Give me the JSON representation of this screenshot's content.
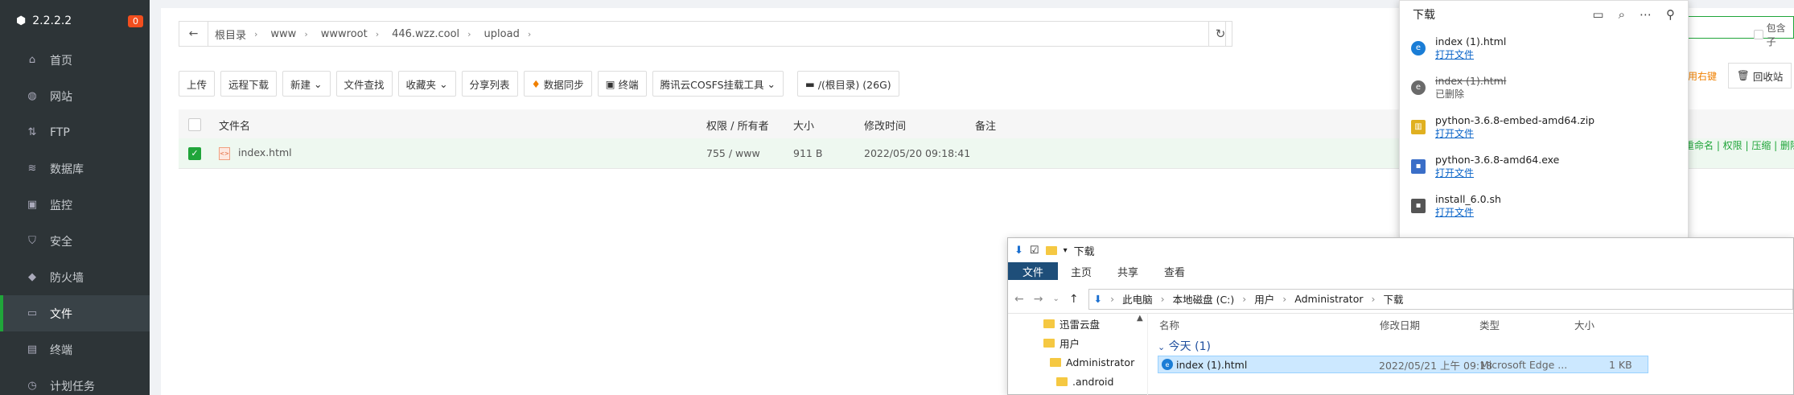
{
  "sidebar": {
    "version": "2.2.2.2",
    "badge": "0",
    "items": [
      {
        "label": "首页",
        "icon": "home-icon"
      },
      {
        "label": "网站",
        "icon": "globe-icon"
      },
      {
        "label": "FTP",
        "icon": "ftp-icon"
      },
      {
        "label": "数据库",
        "icon": "database-icon"
      },
      {
        "label": "监控",
        "icon": "monitor-icon"
      },
      {
        "label": "安全",
        "icon": "shield-icon"
      },
      {
        "label": "防火墙",
        "icon": "firewall-icon"
      },
      {
        "label": "文件",
        "icon": "folder-icon",
        "active": true
      },
      {
        "label": "终端",
        "icon": "terminal-icon"
      },
      {
        "label": "计划任务",
        "icon": "clock-icon"
      }
    ]
  },
  "breadcrumb": [
    "根目录",
    "www",
    "wwwroot",
    "446.wzz.cool",
    "upload"
  ],
  "toolbar": {
    "upload": "上传",
    "remote_download": "远程下载",
    "new": "新建",
    "file_search": "文件查找",
    "favorites": "收藏夹",
    "share_list": "分享列表",
    "sync": "数据同步",
    "terminal": "终端",
    "cosfs": "腾讯云COSFS挂载工具",
    "disk": "/(根目录) (26G)",
    "right_click": "用右键",
    "recycle": "回收站",
    "include_sub": "包含子"
  },
  "table": {
    "headers": {
      "name": "文件名",
      "perm": "权限 / 所有者",
      "size": "大小",
      "mtime": "修改时间",
      "note": "备注"
    },
    "rows": [
      {
        "name": "index.html",
        "perm": "755 / www",
        "size": "911 B",
        "mtime": "2022/05/20 09:18:41",
        "actions": "重命名 | 权限 | 压缩 | 删除"
      }
    ]
  },
  "downloads": {
    "title": "下载",
    "items": [
      {
        "name": "index (1).html",
        "sub": "打开文件",
        "deleted": false,
        "color": "#1a7dd6"
      },
      {
        "name": "index (1).html",
        "sub": "已删除",
        "deleted": true,
        "color": "#6a6a6a"
      },
      {
        "name": "python-3.6.8-embed-amd64.zip",
        "sub": "打开文件",
        "deleted": false,
        "color": "#e0b020"
      },
      {
        "name": "python-3.6.8-amd64.exe",
        "sub": "打开文件",
        "deleted": false,
        "color": "#3a6ec8"
      },
      {
        "name": "install_6.0.sh",
        "sub": "打开文件",
        "deleted": false,
        "color": "#555555"
      }
    ]
  },
  "explorer": {
    "title": "下载",
    "ribbon": [
      "文件",
      "主页",
      "共享",
      "查看"
    ],
    "path": [
      "此电脑",
      "本地磁盘 (C:)",
      "用户",
      "Administrator",
      "下载"
    ],
    "tree": [
      "迅雷云盘",
      "用户",
      "Administrator",
      ".android"
    ],
    "columns": {
      "name": "名称",
      "date": "修改日期",
      "type": "类型",
      "size": "大小"
    },
    "group": "今天 (1)",
    "file": {
      "name": "index (1).html",
      "date": "2022/05/21 上午 09:18",
      "type": "Microsoft Edge ...",
      "size": "1 KB"
    }
  }
}
